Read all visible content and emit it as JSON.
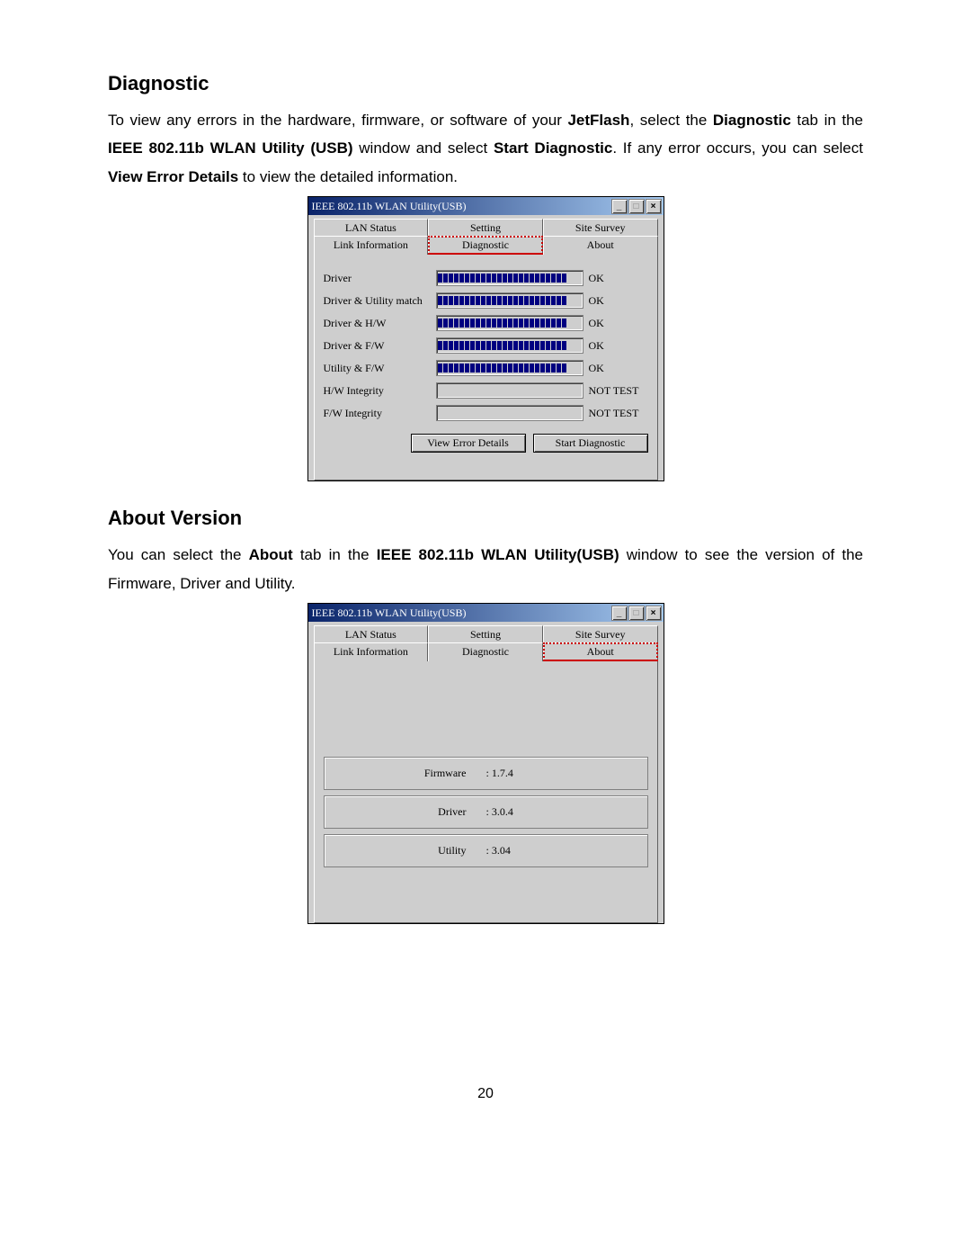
{
  "section1": {
    "heading": "Diagnostic",
    "para": {
      "t1": "To view any errors in the hardware, firmware, or software of your ",
      "b1": "JetFlash",
      "t2": ", select the ",
      "b2": "Diagnostic",
      "t3": " tab in the ",
      "b3": "IEEE 802.11b WLAN Utility (USB)",
      "t4": " window and select ",
      "b4": "Start Diagnostic",
      "t5": ". If any error occurs, you can select ",
      "b5": "View Error Details",
      "t6": " to view the detailed information."
    }
  },
  "section2": {
    "heading": "About Version",
    "para": {
      "t1": "You can select the ",
      "b1": "About",
      "t2": " tab in the ",
      "b2": "IEEE 802.11b WLAN Utility(USB)",
      "t3": " window to see the version of the Firmware, Driver and Utility."
    }
  },
  "window": {
    "title": "IEEE 802.11b WLAN Utility(USB)",
    "tabs": {
      "lan_status": "LAN Status",
      "setting": "Setting",
      "site_survey": "Site Survey",
      "link_info": "Link Information",
      "diagnostic": "Diagnostic",
      "about": "About"
    }
  },
  "diag": {
    "rows": {
      "driver": {
        "label": "Driver",
        "status": "OK"
      },
      "match": {
        "label": "Driver & Utility match",
        "status": "OK"
      },
      "hw": {
        "label": "Driver & H/W",
        "status": "OK"
      },
      "fw": {
        "label": "Driver & F/W",
        "status": "OK"
      },
      "ufw": {
        "label": "Utility & F/W",
        "status": "OK"
      },
      "hwi": {
        "label": "H/W Integrity",
        "status": "NOT TEST"
      },
      "fwi": {
        "label": "F/W Integrity",
        "status": "NOT TEST"
      }
    },
    "buttons": {
      "view_errors": "View Error Details",
      "start": "Start Diagnostic"
    }
  },
  "about": {
    "firmware": {
      "label": "Firmware",
      "value": ": 1.7.4"
    },
    "driver": {
      "label": "Driver",
      "value": ": 3.0.4"
    },
    "utility": {
      "label": "Utility",
      "value": ": 3.04"
    }
  },
  "titlebar_buttons": {
    "min": "_",
    "max": "□",
    "close": "×"
  },
  "page_number": "20"
}
